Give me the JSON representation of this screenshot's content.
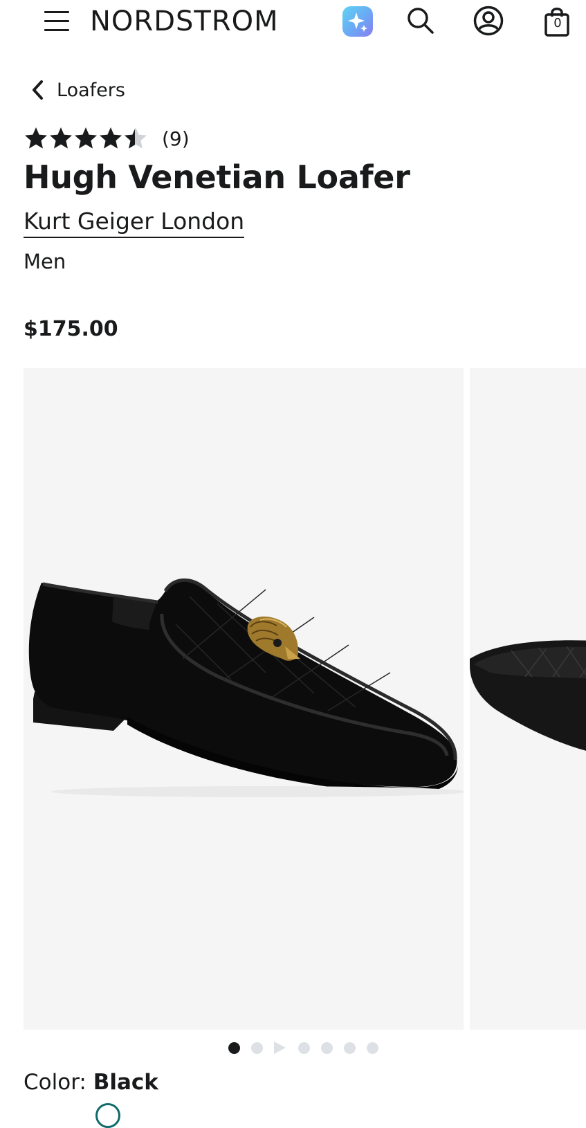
{
  "header": {
    "logo": "NORDSTROM",
    "bag_count": "0",
    "icons": [
      "menu-icon",
      "ai-assistant-icon",
      "search-icon",
      "account-icon",
      "shopping-bag-icon"
    ]
  },
  "breadcrumb": {
    "label": "Loafers"
  },
  "product": {
    "rating": 4.5,
    "review_count": "(9)",
    "title": "Hugh Venetian Loafer",
    "brand": "Kurt Geiger London",
    "gender": "Men",
    "price": "$175.00"
  },
  "gallery": {
    "current_slide": 1,
    "slide_count": 7,
    "has_video_slide": true
  },
  "color": {
    "label": "Color:",
    "value": "Black"
  },
  "colors": {
    "text": "#191a1b",
    "image_bg": "#f5f5f5",
    "dot_inactive": "#dde1e6",
    "swatch_accent": "#0f6b6b"
  }
}
